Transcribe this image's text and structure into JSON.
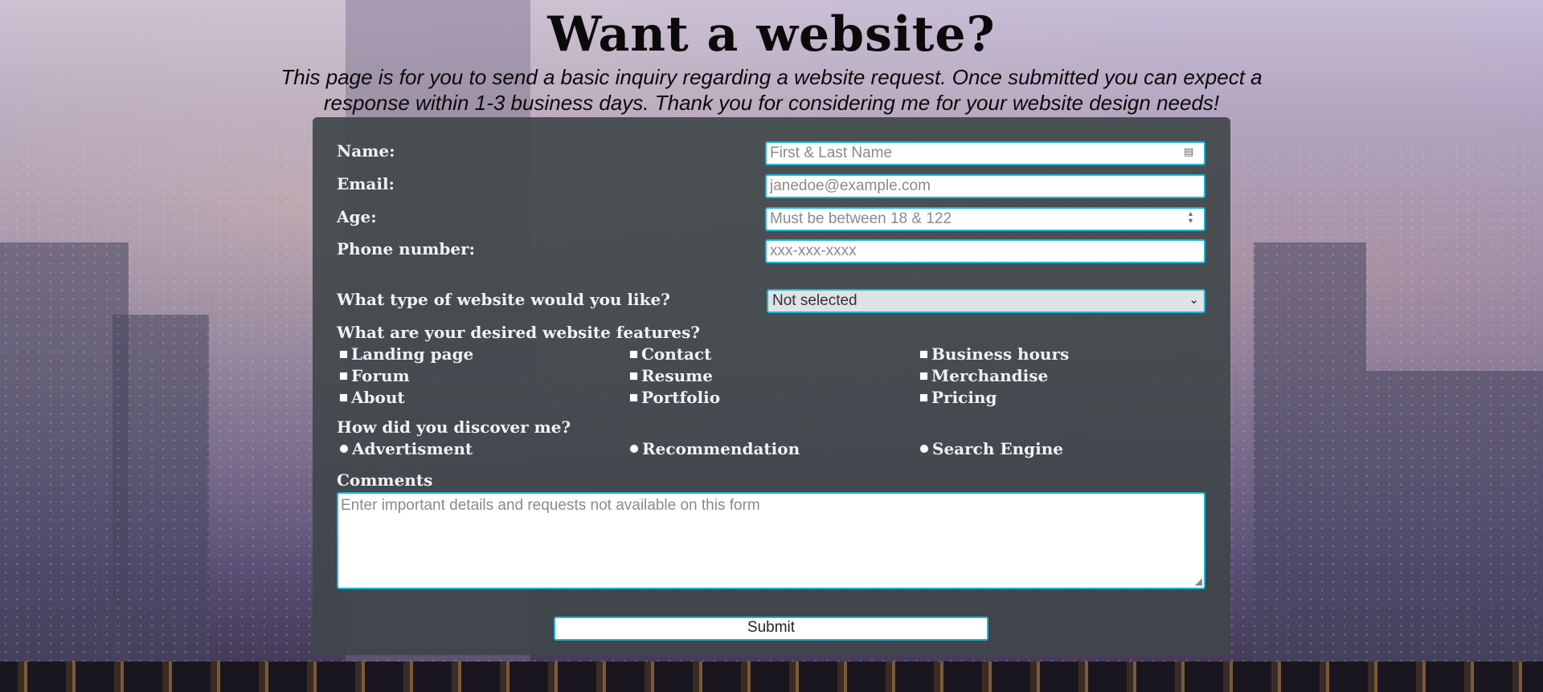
{
  "page": {
    "title": "Want a website?",
    "intro": "This page is for you to send a basic inquiry regarding a website request. Once submitted you can expect a response within 1-3 business days. Thank you for considering me for your website design needs!"
  },
  "form": {
    "name": {
      "label": "Name:",
      "placeholder": "First & Last Name"
    },
    "email": {
      "label": "Email:",
      "placeholder": "janedoe@example.com"
    },
    "age": {
      "label": "Age:",
      "placeholder": "Must be between 18 & 122"
    },
    "phone": {
      "label": "Phone number:",
      "placeholder": "xxx-xxx-xxxx"
    },
    "website_type": {
      "label": "What type of website would you like?",
      "selected": "Not selected"
    },
    "features": {
      "label": "What are your desired website features?",
      "options": [
        "Landing page",
        "Contact",
        "Business hours",
        "Forum",
        "Resume",
        "Merchandise",
        "About",
        "Portfolio",
        "Pricing"
      ]
    },
    "discovery": {
      "label": "How did you discover me?",
      "options": [
        "Advertisment",
        "Recommendation",
        "Search Engine"
      ]
    },
    "comments": {
      "label": "Comments",
      "placeholder": "Enter important details and requests not available on this form"
    },
    "submit_label": "Submit"
  },
  "colors": {
    "accent": "#1bb5d6",
    "card": "#3e4648"
  }
}
